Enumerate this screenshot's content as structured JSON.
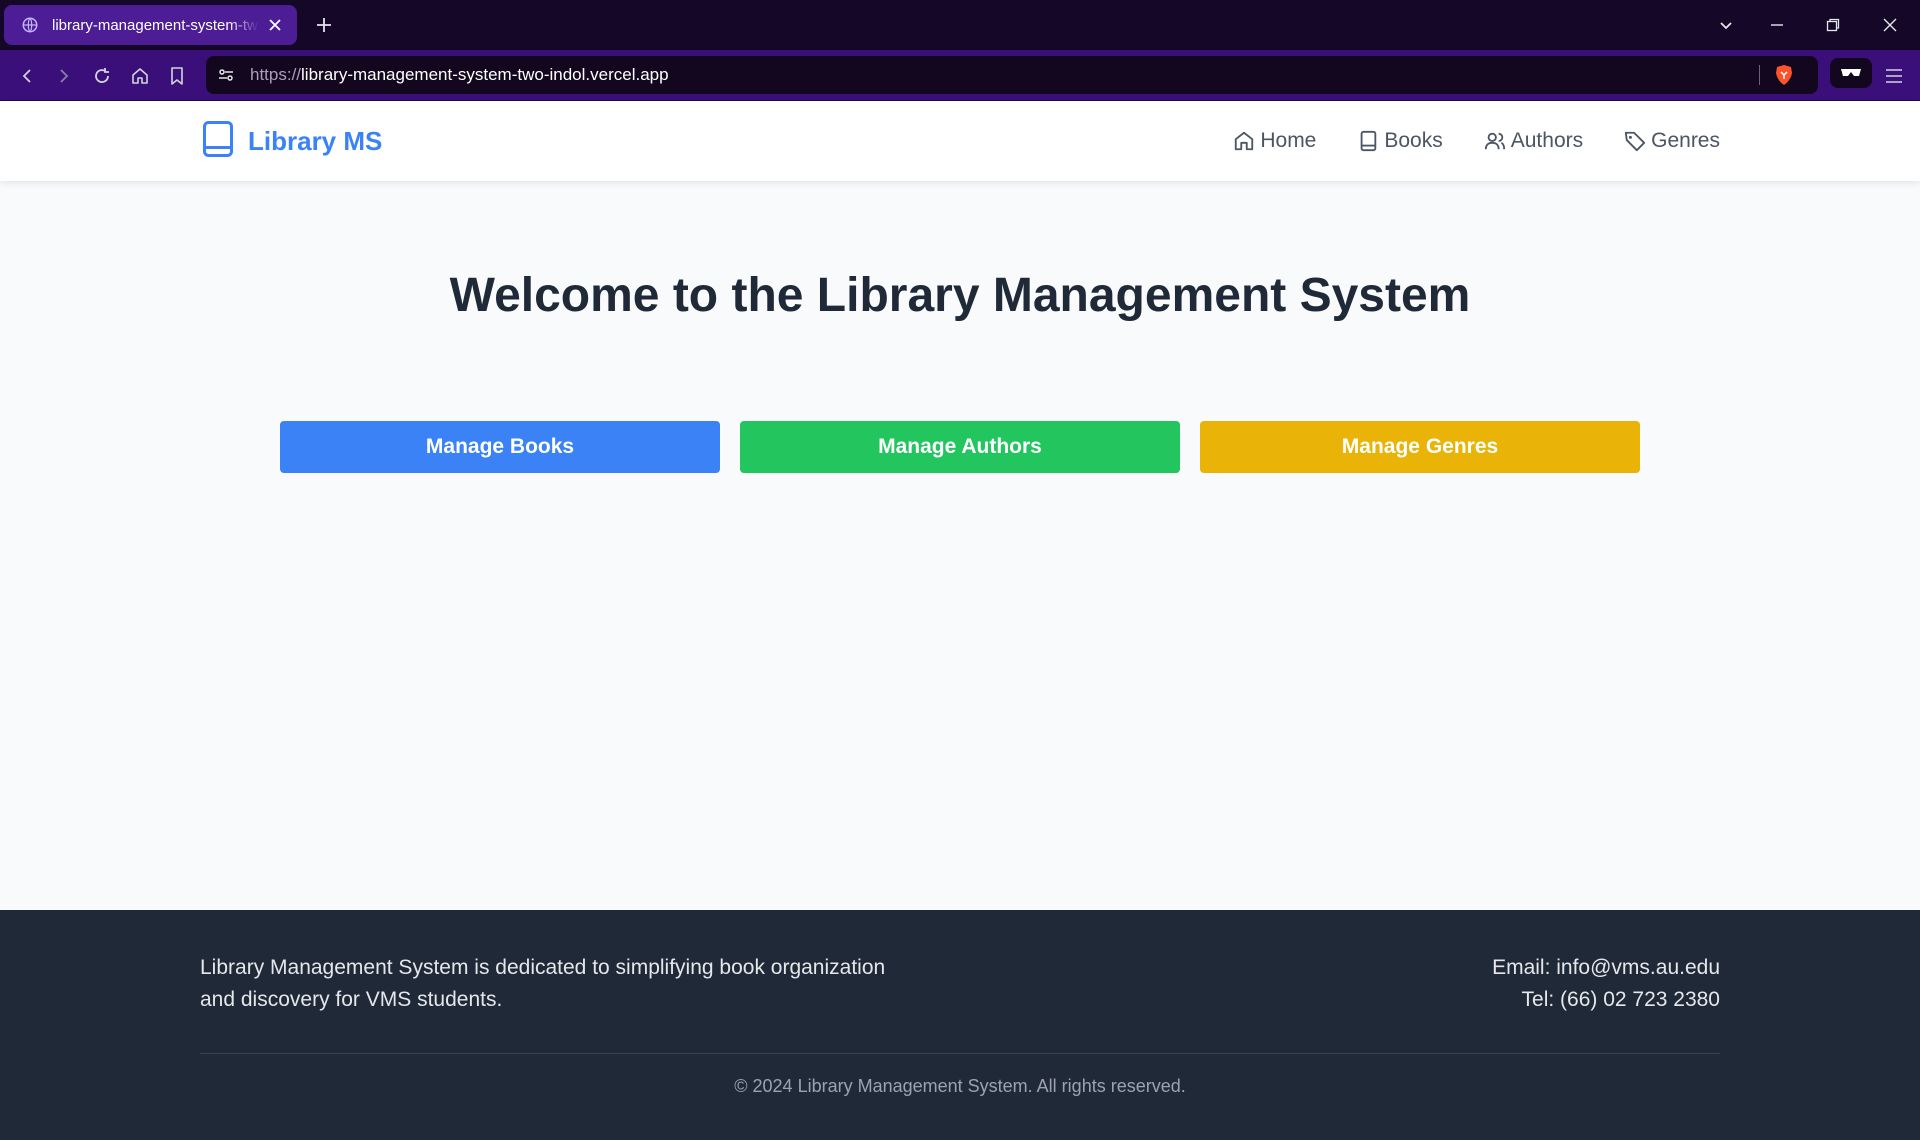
{
  "browser": {
    "tab_title": "library-management-system-two-indol.vercel.app",
    "url_protocol": "https://",
    "url_host": "library-management-system-two-indol.vercel.app"
  },
  "header": {
    "brand": "Library MS",
    "nav": [
      {
        "label": "Home",
        "icon": "home-icon"
      },
      {
        "label": "Books",
        "icon": "book-icon"
      },
      {
        "label": "Authors",
        "icon": "users-icon"
      },
      {
        "label": "Genres",
        "icon": "tag-icon"
      }
    ]
  },
  "main": {
    "title": "Welcome to the Library Management System",
    "buttons": [
      {
        "label": "Manage Books",
        "color": "#3b82f6"
      },
      {
        "label": "Manage Authors",
        "color": "#22c55e"
      },
      {
        "label": "Manage Genres",
        "color": "#eab308"
      }
    ]
  },
  "footer": {
    "about_line1": "Library Management System is dedicated to simplifying book organization",
    "about_line2": "and discovery for VMS students.",
    "email": "Email: info@vms.au.edu",
    "tel": "Tel: (66) 02 723 2380",
    "copyright": "© 2024 Library Management System. All rights reserved."
  },
  "colors": {
    "brand": "#3b82f6",
    "footer_bg": "#1f2937",
    "page_bg": "#f9fafb"
  }
}
